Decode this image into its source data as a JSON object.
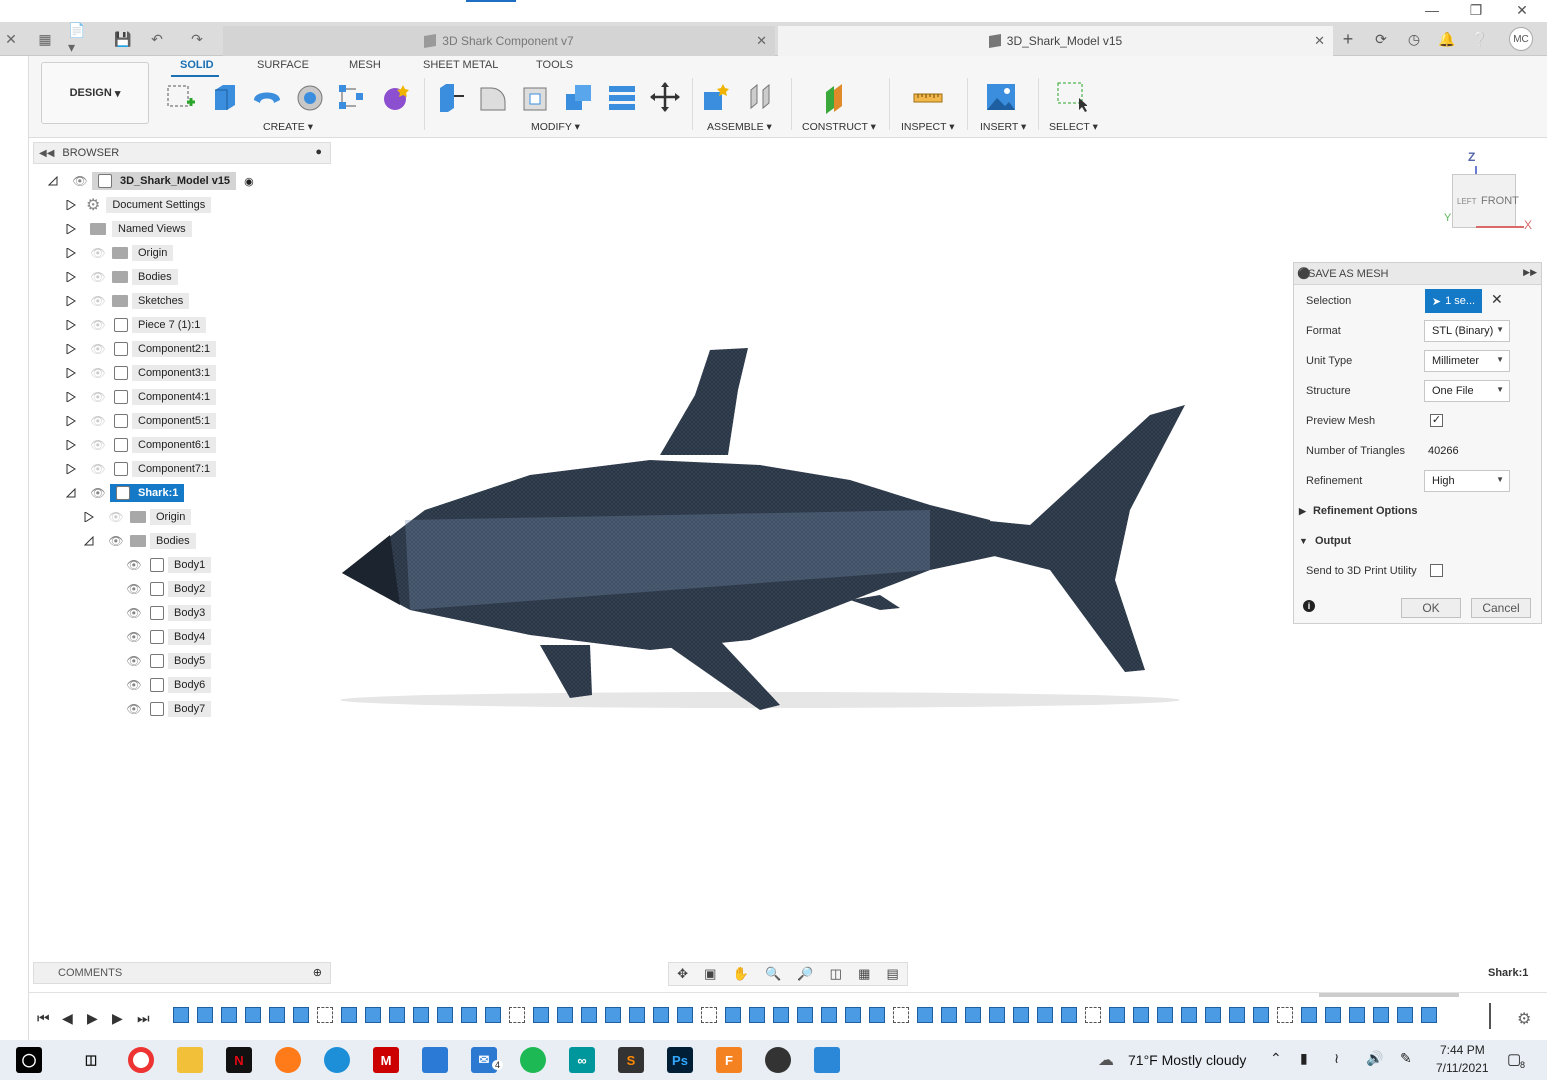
{
  "tabs": [
    {
      "label": "3D Shark Component v7",
      "active": false
    },
    {
      "label": "3D_Shark_Model v15",
      "active": true
    }
  ],
  "user_initials": "MC",
  "ribbon": {
    "workspace": "DESIGN",
    "tabs": [
      "SOLID",
      "SURFACE",
      "MESH",
      "SHEET METAL",
      "TOOLS"
    ],
    "active_tab": "SOLID",
    "groups": [
      "CREATE",
      "MODIFY",
      "ASSEMBLE",
      "CONSTRUCT",
      "INSPECT",
      "INSERT",
      "SELECT"
    ]
  },
  "browser": {
    "title": "BROWSER",
    "items": [
      {
        "label": "3D_Shark_Model v15"
      },
      {
        "label": "Document Settings"
      },
      {
        "label": "Named Views"
      },
      {
        "label": "Origin"
      },
      {
        "label": "Bodies"
      },
      {
        "label": "Sketches"
      },
      {
        "label": "Piece 7 (1):1"
      },
      {
        "label": "Component2:1"
      },
      {
        "label": "Component3:1"
      },
      {
        "label": "Component4:1"
      },
      {
        "label": "Component5:1"
      },
      {
        "label": "Component6:1"
      },
      {
        "label": "Component7:1"
      },
      {
        "label": "Shark:1"
      },
      {
        "label": "Origin"
      },
      {
        "label": "Bodies"
      },
      {
        "label": "Body1"
      },
      {
        "label": "Body2"
      },
      {
        "label": "Body3"
      },
      {
        "label": "Body4"
      },
      {
        "label": "Body5"
      },
      {
        "label": "Body6"
      },
      {
        "label": "Body7"
      }
    ]
  },
  "viewcube": {
    "top": "Z",
    "front": "FRONT",
    "left": "LEFT",
    "x": "X",
    "y": "Y"
  },
  "dialog": {
    "title": "SAVE AS MESH",
    "selection_label": "Selection",
    "selection_value": "1 se...",
    "format_label": "Format",
    "format_value": "STL (Binary)",
    "unit_label": "Unit Type",
    "unit_value": "Millimeter",
    "structure_label": "Structure",
    "structure_value": "One File",
    "preview_label": "Preview Mesh",
    "preview_checked": true,
    "triangles_label": "Number of Triangles",
    "triangles_value": "40266",
    "refinement_label": "Refinement",
    "refinement_value": "High",
    "refinement_options": "Refinement Options",
    "output": "Output",
    "send_label": "Send to 3D Print Utility",
    "send_checked": false,
    "ok": "OK",
    "cancel": "Cancel"
  },
  "comments_label": "COMMENTS",
  "status_selection": "Shark:1",
  "taskbar": {
    "weather": "71°F  Mostly cloudy",
    "time": "7:44 PM",
    "date": "7/11/2021",
    "mail_badge": "4",
    "notif_count": "8"
  },
  "colors": {
    "accent": "#1479c7",
    "shark": "#2a3544"
  }
}
